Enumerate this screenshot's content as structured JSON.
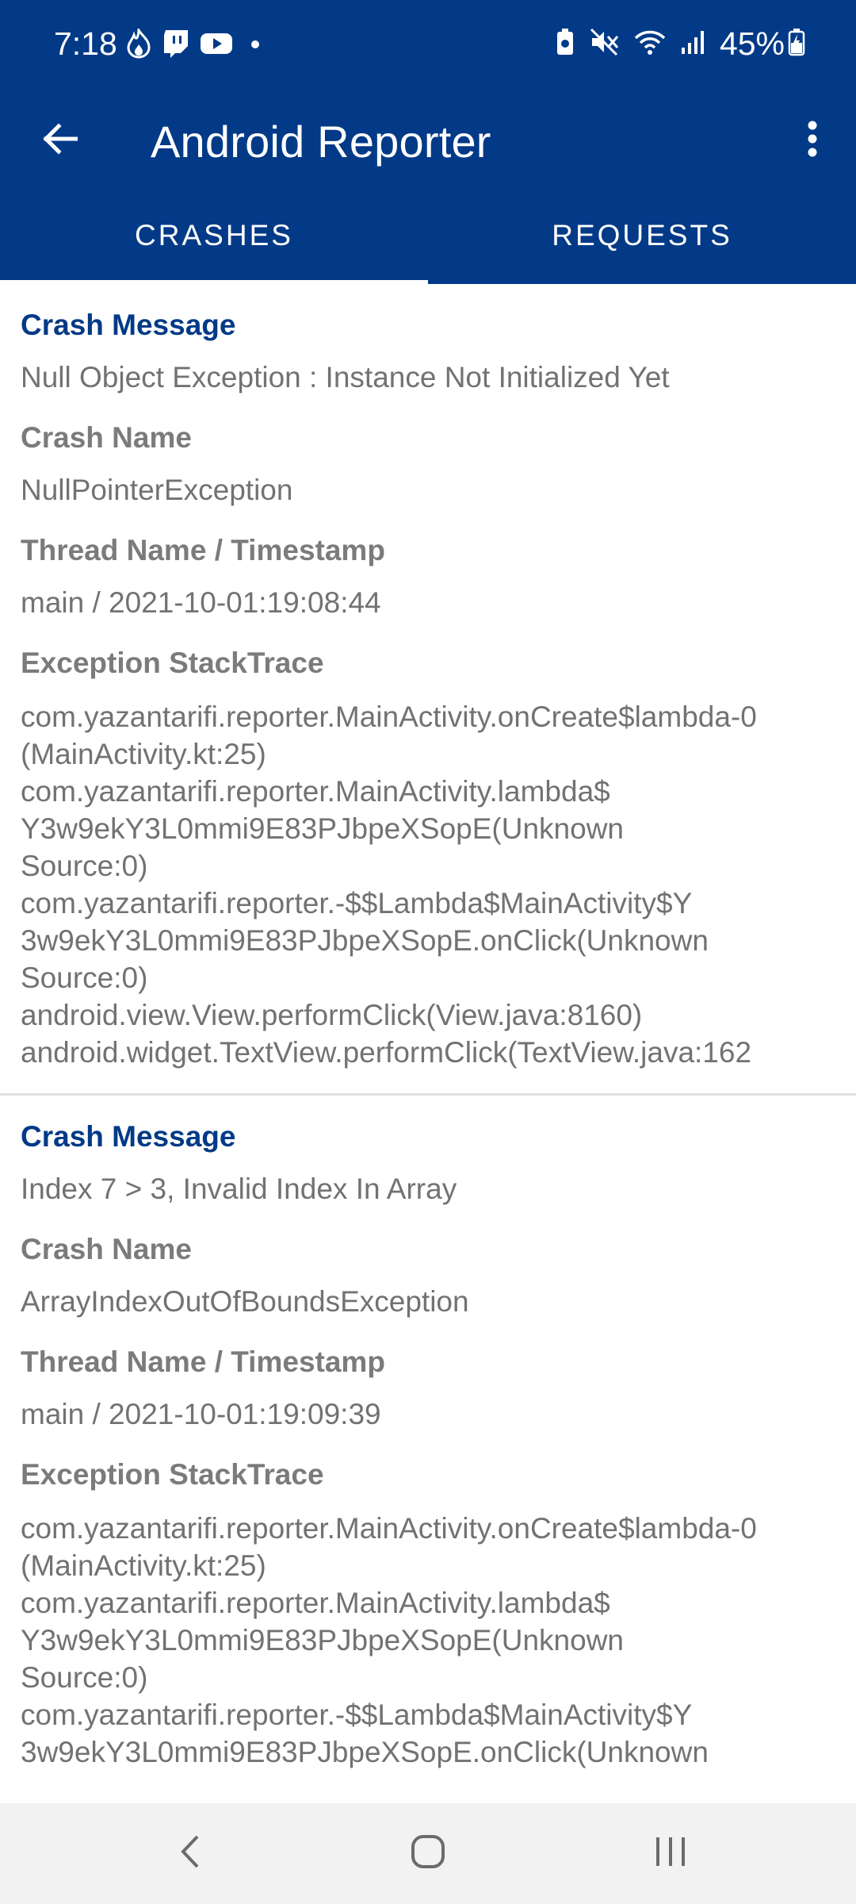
{
  "status_bar": {
    "time": "7:18",
    "battery": "45%",
    "left_icons": [
      "flame-icon",
      "twitch-icon",
      "youtube-icon",
      "dot-icon"
    ],
    "right_icons": [
      "battery-saver-icon",
      "mute-icon",
      "wifi-icon",
      "signal-icon",
      "battery-charging-icon"
    ]
  },
  "app_bar": {
    "title": "Android Reporter",
    "back_icon": "arrow-back-icon",
    "menu_icon": "more-vert-icon"
  },
  "tabs": [
    {
      "label": "CRASHES",
      "active": true
    },
    {
      "label": "REQUESTS",
      "active": false
    }
  ],
  "crashes": [
    {
      "message_label": "Crash Message",
      "message": "Null Object Exception : Instance Not Initialized Yet",
      "name_label": "Crash Name",
      "name": "NullPointerException",
      "thread_label": "Thread Name / Timestamp",
      "thread": "main / 2021-10-01:19:08:44",
      "trace_label": "Exception StackTrace",
      "trace": "com.yazantarifi.reporter.MainActivity.onCreate$lambda-0\n(MainActivity.kt:25)\ncom.yazantarifi.reporter.MainActivity.lambda$\nY3w9ekY3L0mmi9E83PJbpeXSopE(Unknown\nSource:0)\ncom.yazantarifi.reporter.-$$Lambda$MainActivity$Y\n3w9ekY3L0mmi9E83PJbpeXSopE.onClick(Unknown\nSource:0)\nandroid.view.View.performClick(View.java:8160)\nandroid.widget.TextView.performClick(TextView.java:162"
    },
    {
      "message_label": "Crash Message",
      "message": "Index 7 > 3, Invalid Index In Array",
      "name_label": "Crash Name",
      "name": "ArrayIndexOutOfBoundsException",
      "thread_label": "Thread Name / Timestamp",
      "thread": "main / 2021-10-01:19:09:39",
      "trace_label": "Exception StackTrace",
      "trace": "com.yazantarifi.reporter.MainActivity.onCreate$lambda-0\n(MainActivity.kt:25)\ncom.yazantarifi.reporter.MainActivity.lambda$\nY3w9ekY3L0mmi9E83PJbpeXSopE(Unknown\nSource:0)\ncom.yazantarifi.reporter.-$$Lambda$MainActivity$Y\n3w9ekY3L0mmi9E83PJbpeXSopE.onClick(Unknown"
    }
  ],
  "nav_bar": {
    "icons": [
      "nav-back-icon",
      "nav-home-icon",
      "nav-recents-icon"
    ]
  },
  "colors": {
    "primary": "#023a87",
    "label_gray": "#7b7b7b",
    "text_gray": "#727272"
  }
}
